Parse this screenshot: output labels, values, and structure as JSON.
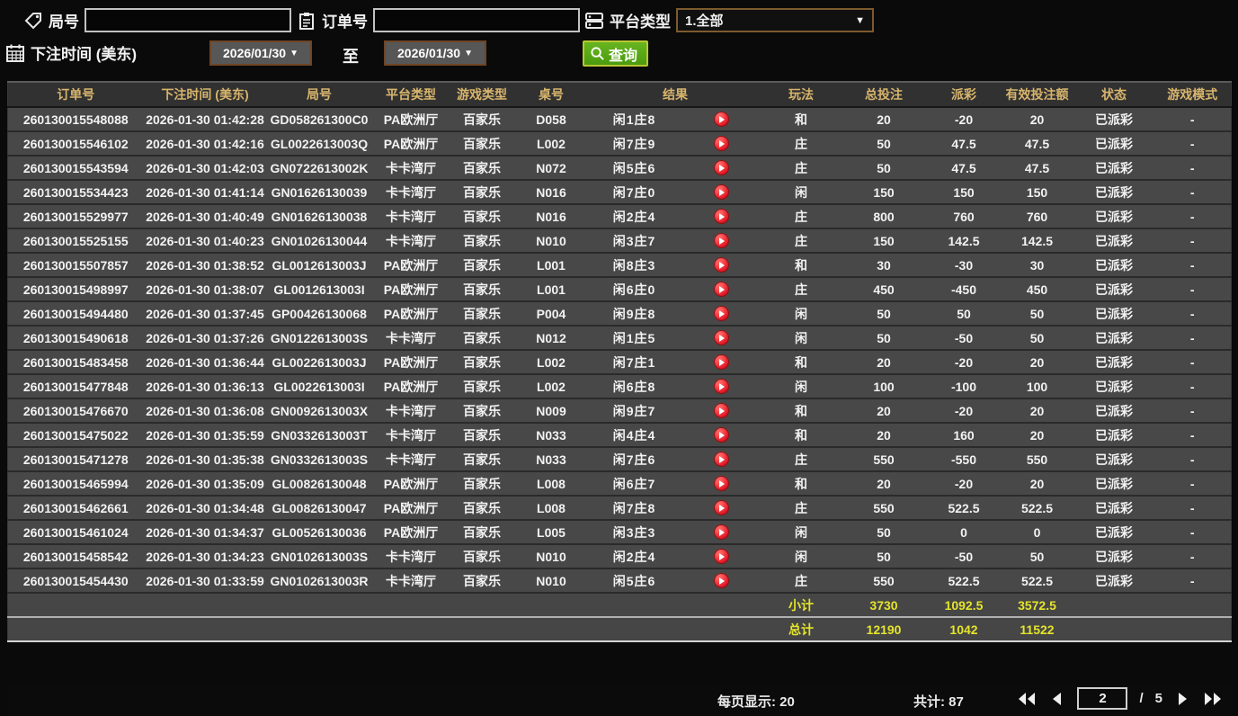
{
  "filters": {
    "game_no": {
      "label": "局号",
      "value": ""
    },
    "order_no": {
      "label": "订单号",
      "value": ""
    },
    "platform_type": {
      "label": "平台类型",
      "selected": "1.全部"
    },
    "bet_time": {
      "label": "下注时间 (美东)",
      "from": "2026/01/30",
      "to_word": "至",
      "to": "2026/01/30"
    },
    "search_label": "查询"
  },
  "table": {
    "headers": [
      "订单号",
      "下注时间 (美东)",
      "局号",
      "平台类型",
      "游戏类型",
      "桌号",
      "结果",
      "玩法",
      "总投注",
      "派彩",
      "有效投注额",
      "状态",
      "游戏模式"
    ],
    "rows": [
      {
        "order_no": "260130015548088",
        "bet_time": "2026-01-30 01:42:28",
        "game_no": "GD058261300C0",
        "platform": "PA欧洲厅",
        "game_type": "百家乐",
        "table_no": "D058",
        "result": "闲1庄8",
        "play": "和",
        "total_bet": "20",
        "payout": "-20",
        "payout_class": "neg",
        "valid_bet": "20",
        "status": "已派彩",
        "mode": "-"
      },
      {
        "order_no": "260130015546102",
        "bet_time": "2026-01-30 01:42:16",
        "game_no": "GL0022613003Q",
        "platform": "PA欧洲厅",
        "game_type": "百家乐",
        "table_no": "L002",
        "result": "闲7庄9",
        "play": "庄",
        "total_bet": "50",
        "payout": "47.5",
        "payout_class": "pos",
        "valid_bet": "47.5",
        "status": "已派彩",
        "mode": "-"
      },
      {
        "order_no": "260130015543594",
        "bet_time": "2026-01-30 01:42:03",
        "game_no": "GN0722613002K",
        "platform": "卡卡湾厅",
        "game_type": "百家乐",
        "table_no": "N072",
        "result": "闲5庄6",
        "play": "庄",
        "total_bet": "50",
        "payout": "47.5",
        "payout_class": "pos",
        "valid_bet": "47.5",
        "status": "已派彩",
        "mode": "-"
      },
      {
        "order_no": "260130015534423",
        "bet_time": "2026-01-30 01:41:14",
        "game_no": "GN01626130039",
        "platform": "卡卡湾厅",
        "game_type": "百家乐",
        "table_no": "N016",
        "result": "闲7庄0",
        "play": "闲",
        "total_bet": "150",
        "payout": "150",
        "payout_class": "pos",
        "valid_bet": "150",
        "status": "已派彩",
        "mode": "-"
      },
      {
        "order_no": "260130015529977",
        "bet_time": "2026-01-30 01:40:49",
        "game_no": "GN01626130038",
        "platform": "卡卡湾厅",
        "game_type": "百家乐",
        "table_no": "N016",
        "result": "闲2庄4",
        "play": "庄",
        "total_bet": "800",
        "payout": "760",
        "payout_class": "pos",
        "valid_bet": "760",
        "status": "已派彩",
        "mode": "-"
      },
      {
        "order_no": "260130015525155",
        "bet_time": "2026-01-30 01:40:23",
        "game_no": "GN01026130044",
        "platform": "卡卡湾厅",
        "game_type": "百家乐",
        "table_no": "N010",
        "result": "闲3庄7",
        "play": "庄",
        "total_bet": "150",
        "payout": "142.5",
        "payout_class": "pos",
        "valid_bet": "142.5",
        "status": "已派彩",
        "mode": "-"
      },
      {
        "order_no": "260130015507857",
        "bet_time": "2026-01-30 01:38:52",
        "game_no": "GL0012613003J",
        "platform": "PA欧洲厅",
        "game_type": "百家乐",
        "table_no": "L001",
        "result": "闲8庄3",
        "play": "和",
        "total_bet": "30",
        "payout": "-30",
        "payout_class": "neg",
        "valid_bet": "30",
        "status": "已派彩",
        "mode": "-"
      },
      {
        "order_no": "260130015498997",
        "bet_time": "2026-01-30 01:38:07",
        "game_no": "GL0012613003I",
        "platform": "PA欧洲厅",
        "game_type": "百家乐",
        "table_no": "L001",
        "result": "闲6庄0",
        "play": "庄",
        "total_bet": "450",
        "payout": "-450",
        "payout_class": "neg",
        "valid_bet": "450",
        "status": "已派彩",
        "mode": "-"
      },
      {
        "order_no": "260130015494480",
        "bet_time": "2026-01-30 01:37:45",
        "game_no": "GP00426130068",
        "platform": "PA欧洲厅",
        "game_type": "百家乐",
        "table_no": "P004",
        "result": "闲9庄8",
        "play": "闲",
        "total_bet": "50",
        "payout": "50",
        "payout_class": "pos",
        "valid_bet": "50",
        "status": "已派彩",
        "mode": "-"
      },
      {
        "order_no": "260130015490618",
        "bet_time": "2026-01-30 01:37:26",
        "game_no": "GN0122613003S",
        "platform": "卡卡湾厅",
        "game_type": "百家乐",
        "table_no": "N012",
        "result": "闲1庄5",
        "play": "闲",
        "total_bet": "50",
        "payout": "-50",
        "payout_class": "neg",
        "valid_bet": "50",
        "status": "已派彩",
        "mode": "-"
      },
      {
        "order_no": "260130015483458",
        "bet_time": "2026-01-30 01:36:44",
        "game_no": "GL0022613003J",
        "platform": "PA欧洲厅",
        "game_type": "百家乐",
        "table_no": "L002",
        "result": "闲7庄1",
        "play": "和",
        "total_bet": "20",
        "payout": "-20",
        "payout_class": "neg",
        "valid_bet": "20",
        "status": "已派彩",
        "mode": "-"
      },
      {
        "order_no": "260130015477848",
        "bet_time": "2026-01-30 01:36:13",
        "game_no": "GL0022613003I",
        "platform": "PA欧洲厅",
        "game_type": "百家乐",
        "table_no": "L002",
        "result": "闲6庄8",
        "play": "闲",
        "total_bet": "100",
        "payout": "-100",
        "payout_class": "neg",
        "valid_bet": "100",
        "status": "已派彩",
        "mode": "-"
      },
      {
        "order_no": "260130015476670",
        "bet_time": "2026-01-30 01:36:08",
        "game_no": "GN0092613003X",
        "platform": "卡卡湾厅",
        "game_type": "百家乐",
        "table_no": "N009",
        "result": "闲9庄7",
        "play": "和",
        "total_bet": "20",
        "payout": "-20",
        "payout_class": "neg",
        "valid_bet": "20",
        "status": "已派彩",
        "mode": "-"
      },
      {
        "order_no": "260130015475022",
        "bet_time": "2026-01-30 01:35:59",
        "game_no": "GN0332613003T",
        "platform": "卡卡湾厅",
        "game_type": "百家乐",
        "table_no": "N033",
        "result": "闲4庄4",
        "play": "和",
        "total_bet": "20",
        "payout": "160",
        "payout_class": "pos",
        "valid_bet": "20",
        "status": "已派彩",
        "mode": "-"
      },
      {
        "order_no": "260130015471278",
        "bet_time": "2026-01-30 01:35:38",
        "game_no": "GN0332613003S",
        "platform": "卡卡湾厅",
        "game_type": "百家乐",
        "table_no": "N033",
        "result": "闲7庄6",
        "play": "庄",
        "total_bet": "550",
        "payout": "-550",
        "payout_class": "neg",
        "valid_bet": "550",
        "status": "已派彩",
        "mode": "-"
      },
      {
        "order_no": "260130015465994",
        "bet_time": "2026-01-30 01:35:09",
        "game_no": "GL00826130048",
        "platform": "PA欧洲厅",
        "game_type": "百家乐",
        "table_no": "L008",
        "result": "闲6庄7",
        "play": "和",
        "total_bet": "20",
        "payout": "-20",
        "payout_class": "neg",
        "valid_bet": "20",
        "status": "已派彩",
        "mode": "-"
      },
      {
        "order_no": "260130015462661",
        "bet_time": "2026-01-30 01:34:48",
        "game_no": "GL00826130047",
        "platform": "PA欧洲厅",
        "game_type": "百家乐",
        "table_no": "L008",
        "result": "闲7庄8",
        "play": "庄",
        "total_bet": "550",
        "payout": "522.5",
        "payout_class": "pos",
        "valid_bet": "522.5",
        "status": "已派彩",
        "mode": "-"
      },
      {
        "order_no": "260130015461024",
        "bet_time": "2026-01-30 01:34:37",
        "game_no": "GL00526130036",
        "platform": "PA欧洲厅",
        "game_type": "百家乐",
        "table_no": "L005",
        "result": "闲3庄3",
        "play": "闲",
        "total_bet": "50",
        "payout": "0",
        "payout_class": "zero",
        "valid_bet": "0",
        "status": "已派彩",
        "mode": "-"
      },
      {
        "order_no": "260130015458542",
        "bet_time": "2026-01-30 01:34:23",
        "game_no": "GN0102613003S",
        "platform": "卡卡湾厅",
        "game_type": "百家乐",
        "table_no": "N010",
        "result": "闲2庄4",
        "play": "闲",
        "total_bet": "50",
        "payout": "-50",
        "payout_class": "neg",
        "valid_bet": "50",
        "status": "已派彩",
        "mode": "-"
      },
      {
        "order_no": "260130015454430",
        "bet_time": "2026-01-30 01:33:59",
        "game_no": "GN0102613003R",
        "platform": "卡卡湾厅",
        "game_type": "百家乐",
        "table_no": "N010",
        "result": "闲5庄6",
        "play": "庄",
        "total_bet": "550",
        "payout": "522.5",
        "payout_class": "pos",
        "valid_bet": "522.5",
        "status": "已派彩",
        "mode": "-"
      }
    ]
  },
  "summary": {
    "subtotal": {
      "label": "小计",
      "total_bet": "3730",
      "payout": "1092.5",
      "valid_bet": "3572.5"
    },
    "total": {
      "label": "总计",
      "total_bet": "12190",
      "payout": "1042",
      "valid_bet": "11522"
    }
  },
  "pagination": {
    "per_page_text": "每页显示: 20",
    "total_text": "共计: 87",
    "current_page": "2",
    "separator": "/",
    "total_pages": "5"
  },
  "colors": {
    "header_text": "#d8b56d",
    "row_bg": "#484848",
    "payout_negative": "#9ade3c",
    "payout_positive": "#b2223c",
    "status_paid": "#33e833",
    "summary_text": "#e4e42c",
    "search_button": "#55a816",
    "play_icon": "#dd1020"
  }
}
